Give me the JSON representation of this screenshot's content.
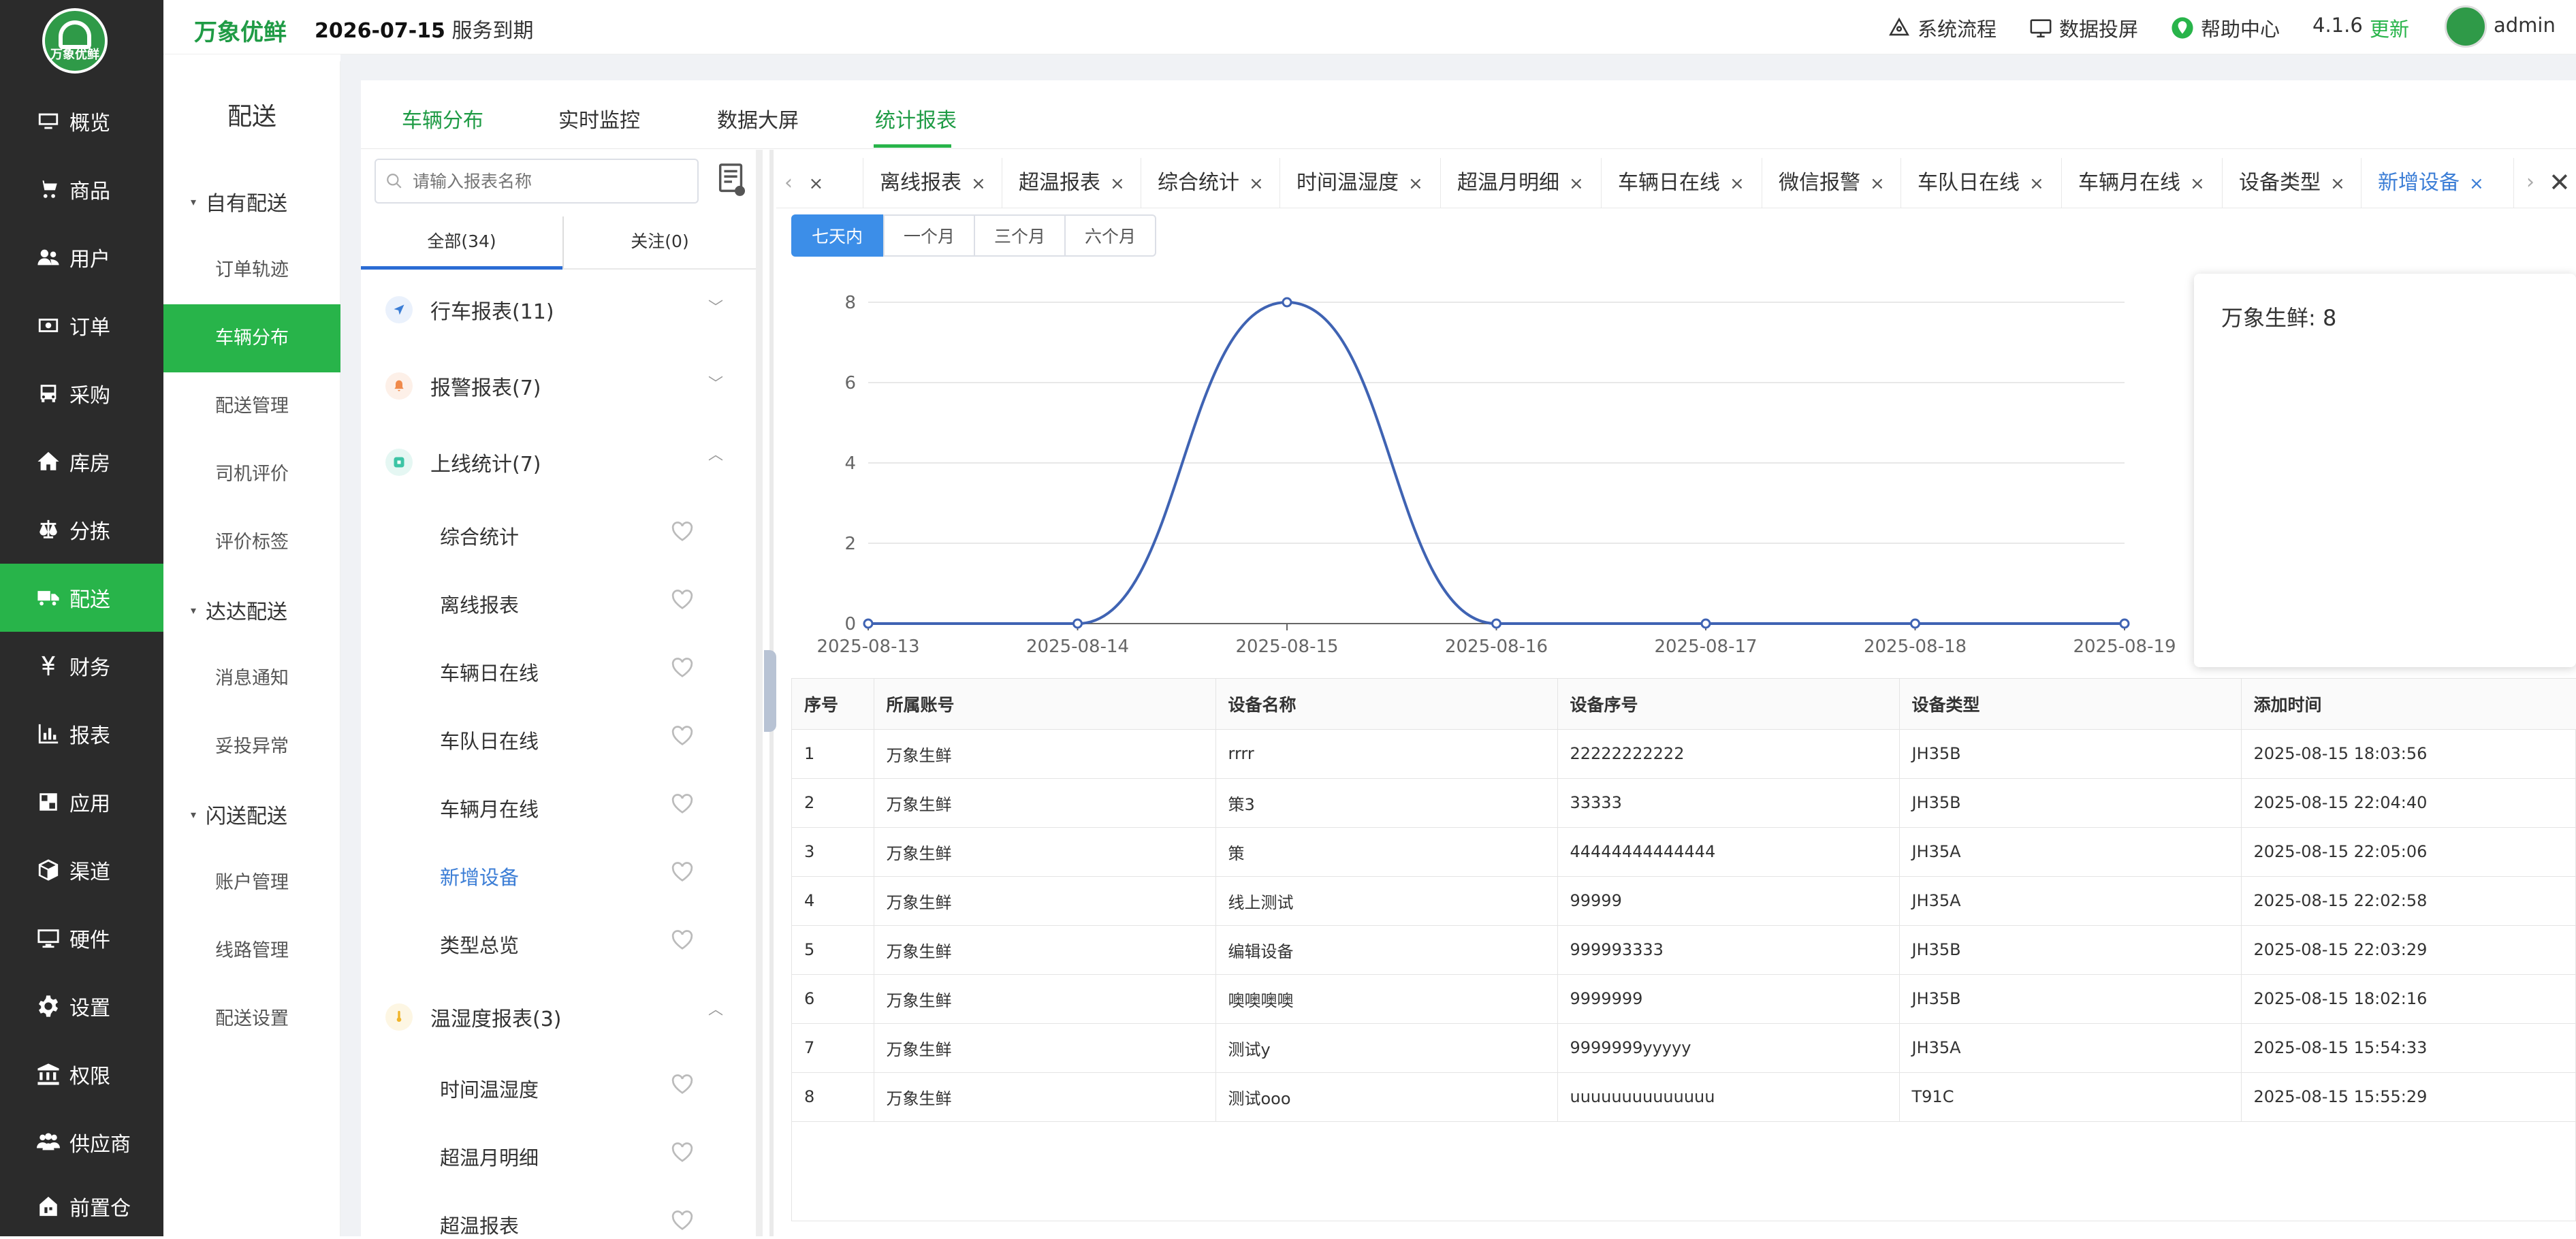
{
  "sidebar": {
    "logo_text": "万象优鲜",
    "items": [
      {
        "label": "概览",
        "icon": "monitor-icon"
      },
      {
        "label": "商品",
        "icon": "cart-icon"
      },
      {
        "label": "用户",
        "icon": "users-icon"
      },
      {
        "label": "订单",
        "icon": "money-icon"
      },
      {
        "label": "采购",
        "icon": "bus-icon"
      },
      {
        "label": "库房",
        "icon": "home-icon"
      },
      {
        "label": "分拣",
        "icon": "scale-icon"
      },
      {
        "label": "配送",
        "icon": "truck-icon"
      },
      {
        "label": "财务",
        "icon": "yen-icon"
      },
      {
        "label": "报表",
        "icon": "bar-chart-icon"
      },
      {
        "label": "应用",
        "icon": "apps-icon"
      },
      {
        "label": "渠道",
        "icon": "cube-icon"
      },
      {
        "label": "硬件",
        "icon": "desktop-icon"
      },
      {
        "label": "设置",
        "icon": "gear-icon"
      },
      {
        "label": "权限",
        "icon": "bank-icon"
      },
      {
        "label": "供应商",
        "icon": "group-icon"
      },
      {
        "label": "前置仓",
        "icon": "building-icon"
      }
    ]
  },
  "subnav": {
    "title": "配送",
    "groups": [
      "自有配送",
      "达达配送",
      "闪送配送"
    ],
    "items": [
      "订单轨迹",
      "车辆分布",
      "配送管理",
      "司机评价",
      "评价标签",
      "消息通知",
      "妥投异常",
      "账户管理",
      "线路管理",
      "配送设置"
    ]
  },
  "topbar": {
    "brand": "万象优鲜",
    "expire_date": "2026-07-15",
    "expire_text": "服务到期",
    "links": [
      "系统流程",
      "数据投屏",
      "帮助中心"
    ],
    "version": "4.1.6",
    "update": "更新",
    "user": "admin"
  },
  "main_tabs": [
    "车辆分布",
    "实时监控",
    "数据大屏",
    "统计报表"
  ],
  "report_panel": {
    "search_placeholder": "请输入报表名称",
    "tab_all": "全部(34)",
    "tab_follow": "关注(0)",
    "categories": [
      {
        "label": "行车报表(11)"
      },
      {
        "label": "报警报表(7)"
      },
      {
        "label": "上线统计(7)"
      },
      {
        "label": "温湿度报表(3)"
      }
    ],
    "online_reports": [
      "综合统计",
      "离线报表",
      "车辆日在线",
      "车队日在线",
      "车辆月在线",
      "新增设备",
      "类型总览"
    ],
    "temp_reports": [
      "时间温湿度",
      "超温月明细",
      "超温报表"
    ]
  },
  "report_tabs": [
    "离线报表",
    "超温报表",
    "综合统计",
    "时间温湿度",
    "超温月明细",
    "车辆日在线",
    "微信报警",
    "车队日在线",
    "车辆月在线",
    "设备类型",
    "新增设备"
  ],
  "range_buttons": [
    "七天内",
    "一个月",
    "三个月",
    "六个月"
  ],
  "chart_data": {
    "type": "line",
    "x": [
      "2025-08-13",
      "2025-08-14",
      "2025-08-15",
      "2025-08-16",
      "2025-08-17",
      "2025-08-18",
      "2025-08-19"
    ],
    "series": [
      {
        "name": "万象生鲜",
        "values": [
          0,
          0,
          8,
          0,
          0,
          0,
          0
        ]
      }
    ],
    "yticks": [
      0,
      2,
      4,
      6,
      8
    ],
    "ylim": [
      0,
      8
    ],
    "grid": true,
    "color": "#3f63b3"
  },
  "tooltip": {
    "text": "万象生鲜: 8"
  },
  "table": {
    "headers": [
      "序号",
      "所属账号",
      "设备名称",
      "设备序号",
      "设备类型",
      "添加时间"
    ],
    "rows": [
      [
        "1",
        "万象生鲜",
        "rrrr",
        "22222222222",
        "JH35B",
        "2025-08-15 18:03:56"
      ],
      [
        "2",
        "万象生鲜",
        "策3",
        "33333",
        "JH35B",
        "2025-08-15 22:04:40"
      ],
      [
        "3",
        "万象生鲜",
        "策",
        "44444444444444",
        "JH35A",
        "2025-08-15 22:05:06"
      ],
      [
        "4",
        "万象生鲜",
        "线上测试",
        "99999",
        "JH35A",
        "2025-08-15 22:02:58"
      ],
      [
        "5",
        "万象生鲜",
        "编辑设备",
        "999993333",
        "JH35B",
        "2025-08-15 22:03:29"
      ],
      [
        "6",
        "万象生鲜",
        "噢噢噢噢",
        "9999999",
        "JH35B",
        "2025-08-15 18:02:16"
      ],
      [
        "7",
        "万象生鲜",
        "测试y",
        "9999999yyyyy",
        "JH35A",
        "2025-08-15 15:54:33"
      ],
      [
        "8",
        "万象生鲜",
        "测试ooo",
        "uuuuuuuuuuuuuu",
        "T91C",
        "2025-08-15 15:55:29"
      ]
    ]
  },
  "colors": {
    "green": "#28b44a",
    "blue": "#3c7ed6",
    "sidebar": "#2b2b2b"
  }
}
